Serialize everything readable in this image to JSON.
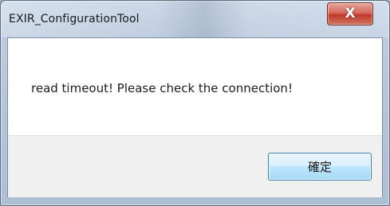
{
  "window": {
    "title": "EXIR_ConfigurationTool"
  },
  "title_bar": {
    "close_icon": "close-icon",
    "close_glyph": "X"
  },
  "dialog": {
    "message": "read timeout! Please check the connection!",
    "ok_label": "確定"
  },
  "colors": {
    "close_button": "#c9463a",
    "ok_button_border": "#3c7fb1",
    "button_area": "#f0f0f0"
  }
}
